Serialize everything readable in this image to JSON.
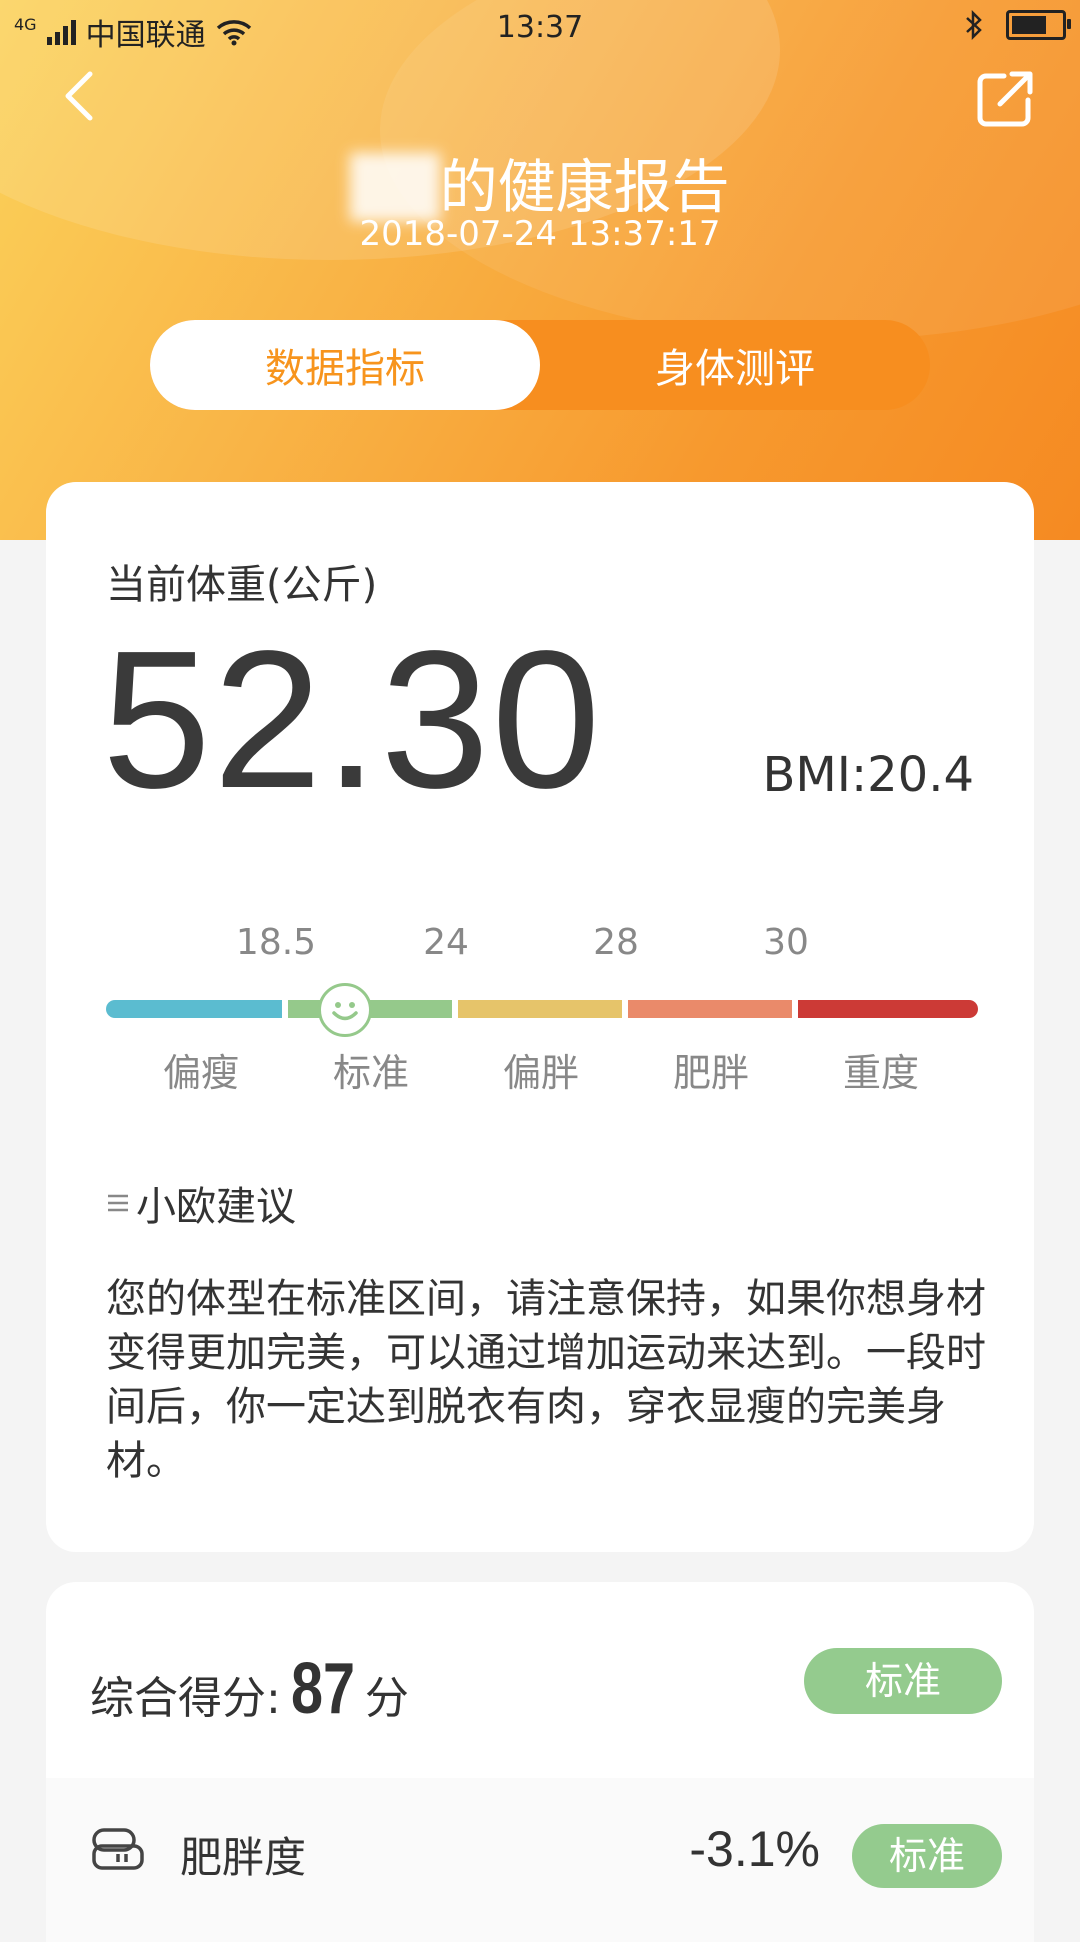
{
  "status_bar": {
    "network": "4G",
    "carrier": "中国联通",
    "time": "13:37"
  },
  "header": {
    "name": "██",
    "title_suffix": "的健康报告",
    "datetime": "2018-07-24 13:37:17"
  },
  "tabs": [
    {
      "label": "数据指标",
      "active": true
    },
    {
      "label": "身体测评",
      "active": false
    }
  ],
  "weight_card": {
    "label": "当前体重(公斤)",
    "value": "52.30",
    "bmi": "BMI:20.4",
    "bmi_value": 20.4,
    "scale_ticks": [
      "18.5",
      "24",
      "28",
      "30"
    ],
    "categories": [
      "偏瘦",
      "标准",
      "偏胖",
      "肥胖",
      "重度"
    ],
    "category_colors": [
      "#5bbcd0",
      "#95c98b",
      "#e6c46a",
      "#ea8a6a",
      "#cc3a36"
    ],
    "current_category": "标准",
    "advice_title": "小欧建议",
    "advice_text": "您的体型在标准区间，请注意保持，如果你想身材变得更加完美，可以通过增加运动来达到。一段时间后，你一定达到脱衣有肉，穿衣显瘦的完美身材。"
  },
  "score_card": {
    "label": "综合得分:",
    "score": "87",
    "unit": "分",
    "badge": "标准",
    "rows": [
      {
        "icon": "body-fat-icon",
        "name": "肥胖度",
        "value": "-3.1%",
        "badge": "标准"
      }
    ]
  },
  "colors": {
    "accent": "#f7941d",
    "badge_green": "#94cb8e"
  }
}
